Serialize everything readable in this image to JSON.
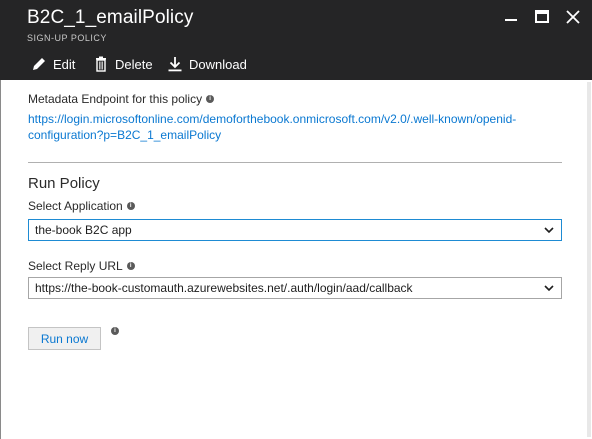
{
  "window": {
    "title": "B2C_1_emailPolicy",
    "subtitle": "SIGN-UP POLICY"
  },
  "toolbar": {
    "edit_label": "Edit",
    "delete_label": "Delete",
    "download_label": "Download"
  },
  "metadata": {
    "label": "Metadata Endpoint for this policy",
    "url_line1": "https://login.microsoftonline.com/demoforthebook.onmicrosoft.com/v2.0/.well-known/openid-",
    "url_line2": "configuration?p=B2C_1_emailPolicy"
  },
  "run_policy": {
    "title": "Run Policy",
    "application_label": "Select Application",
    "application_value": "the-book B2C app",
    "reply_url_label": "Select Reply URL",
    "reply_url_value": "https://the-book-customauth.azurewebsites.net/.auth/login/aad/callback",
    "run_button_label": "Run now"
  },
  "icons": {
    "info": "info-icon",
    "edit": "pencil-icon",
    "delete": "trash-icon",
    "download": "download-icon",
    "minimize": "minimize-icon",
    "maximize": "maximize-icon",
    "close": "close-icon",
    "dropdown": "chevron-down-icon"
  },
  "colors": {
    "header_bg": "#252526",
    "link": "#0a78d1",
    "focus_border": "#1e8bd3"
  }
}
